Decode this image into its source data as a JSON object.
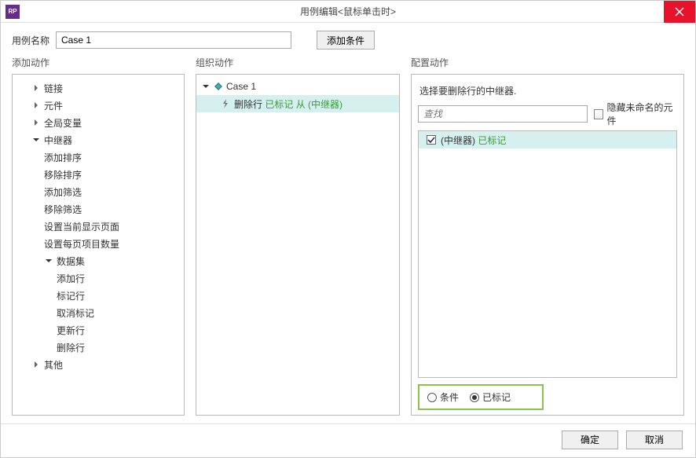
{
  "titlebar": {
    "app_icon_text": "RP",
    "title": "用例编辑<鼠标单击时>"
  },
  "top": {
    "case_name_label": "用例名称",
    "case_name_value": "Case 1",
    "add_condition": "添加条件"
  },
  "columns": {
    "col1_header": "添加动作",
    "col2_header": "组织动作",
    "col3_header": "配置动作"
  },
  "tree": {
    "links": "链接",
    "widgets": "元件",
    "globals": "全局变量",
    "repeater": "中继器",
    "repeater_children": {
      "add_sort": "添加排序",
      "remove_sort": "移除排序",
      "add_filter": "添加筛选",
      "remove_filter": "移除筛选",
      "set_current_page": "设置当前显示页面",
      "set_items_per_page": "设置每页项目数量",
      "dataset": "数据集",
      "dataset_children": {
        "add_rows": "添加行",
        "mark_rows": "标记行",
        "unmark_rows": "取消标记",
        "update_rows": "更新行",
        "delete_rows": "删除行"
      }
    },
    "other": "其他"
  },
  "case_tree": {
    "case_label": "Case 1",
    "action_prefix": "删除行",
    "action_suffix": "已标记 从 (中继器)"
  },
  "config": {
    "label": "选择要删除行的中继器.",
    "search_placeholder": "查找",
    "hide_unnamed": "隐藏未命名的元件",
    "list_item_prefix": "(中继器)",
    "list_item_suffix": "已标记",
    "radio_condition": "条件",
    "radio_marked": "已标记"
  },
  "footer": {
    "ok": "确定",
    "cancel": "取消"
  }
}
